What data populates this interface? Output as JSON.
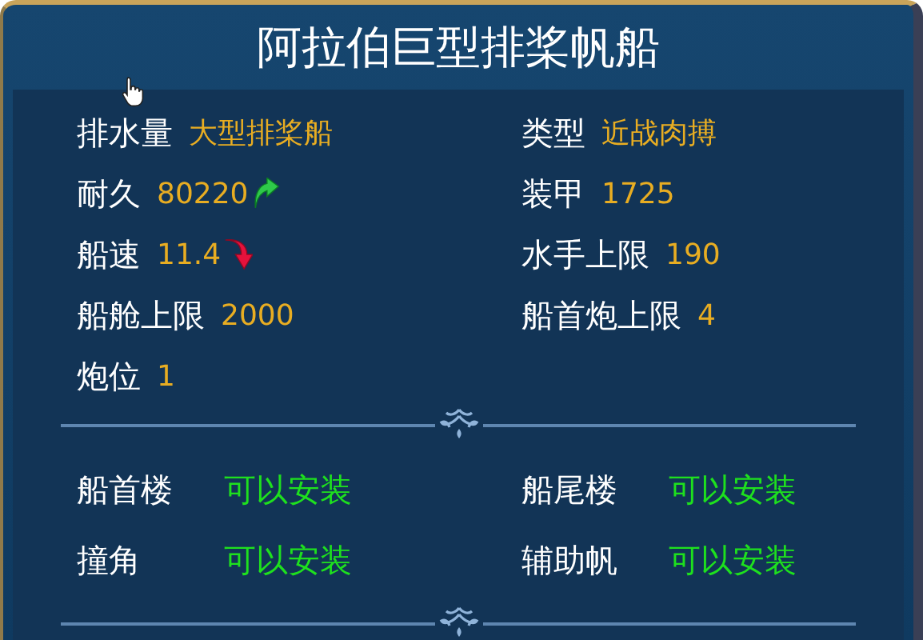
{
  "title": "阿拉伯巨型排桨帆船",
  "stats": [
    {
      "label": "排水量",
      "value": "大型排桨船"
    },
    {
      "label": "类型",
      "value": "近战肉搏"
    },
    {
      "label": "耐久",
      "value": "80220",
      "increased": true
    },
    {
      "label": "装甲",
      "value": "1725"
    },
    {
      "label": "船速",
      "value": "11.4",
      "decreased": true
    },
    {
      "label": "水手上限",
      "value": "190"
    },
    {
      "label": "船舱上限",
      "value": "2000"
    },
    {
      "label": "船首炮上限",
      "value": "4"
    },
    {
      "label": "炮位",
      "value": "1"
    }
  ],
  "slots": [
    {
      "label": "船首楼",
      "status": "可以安装"
    },
    {
      "label": "船尾楼",
      "status": "可以安装"
    },
    {
      "label": "撞角",
      "status": "可以安装"
    },
    {
      "label": "辅助帆",
      "status": "可以安装"
    }
  ]
}
